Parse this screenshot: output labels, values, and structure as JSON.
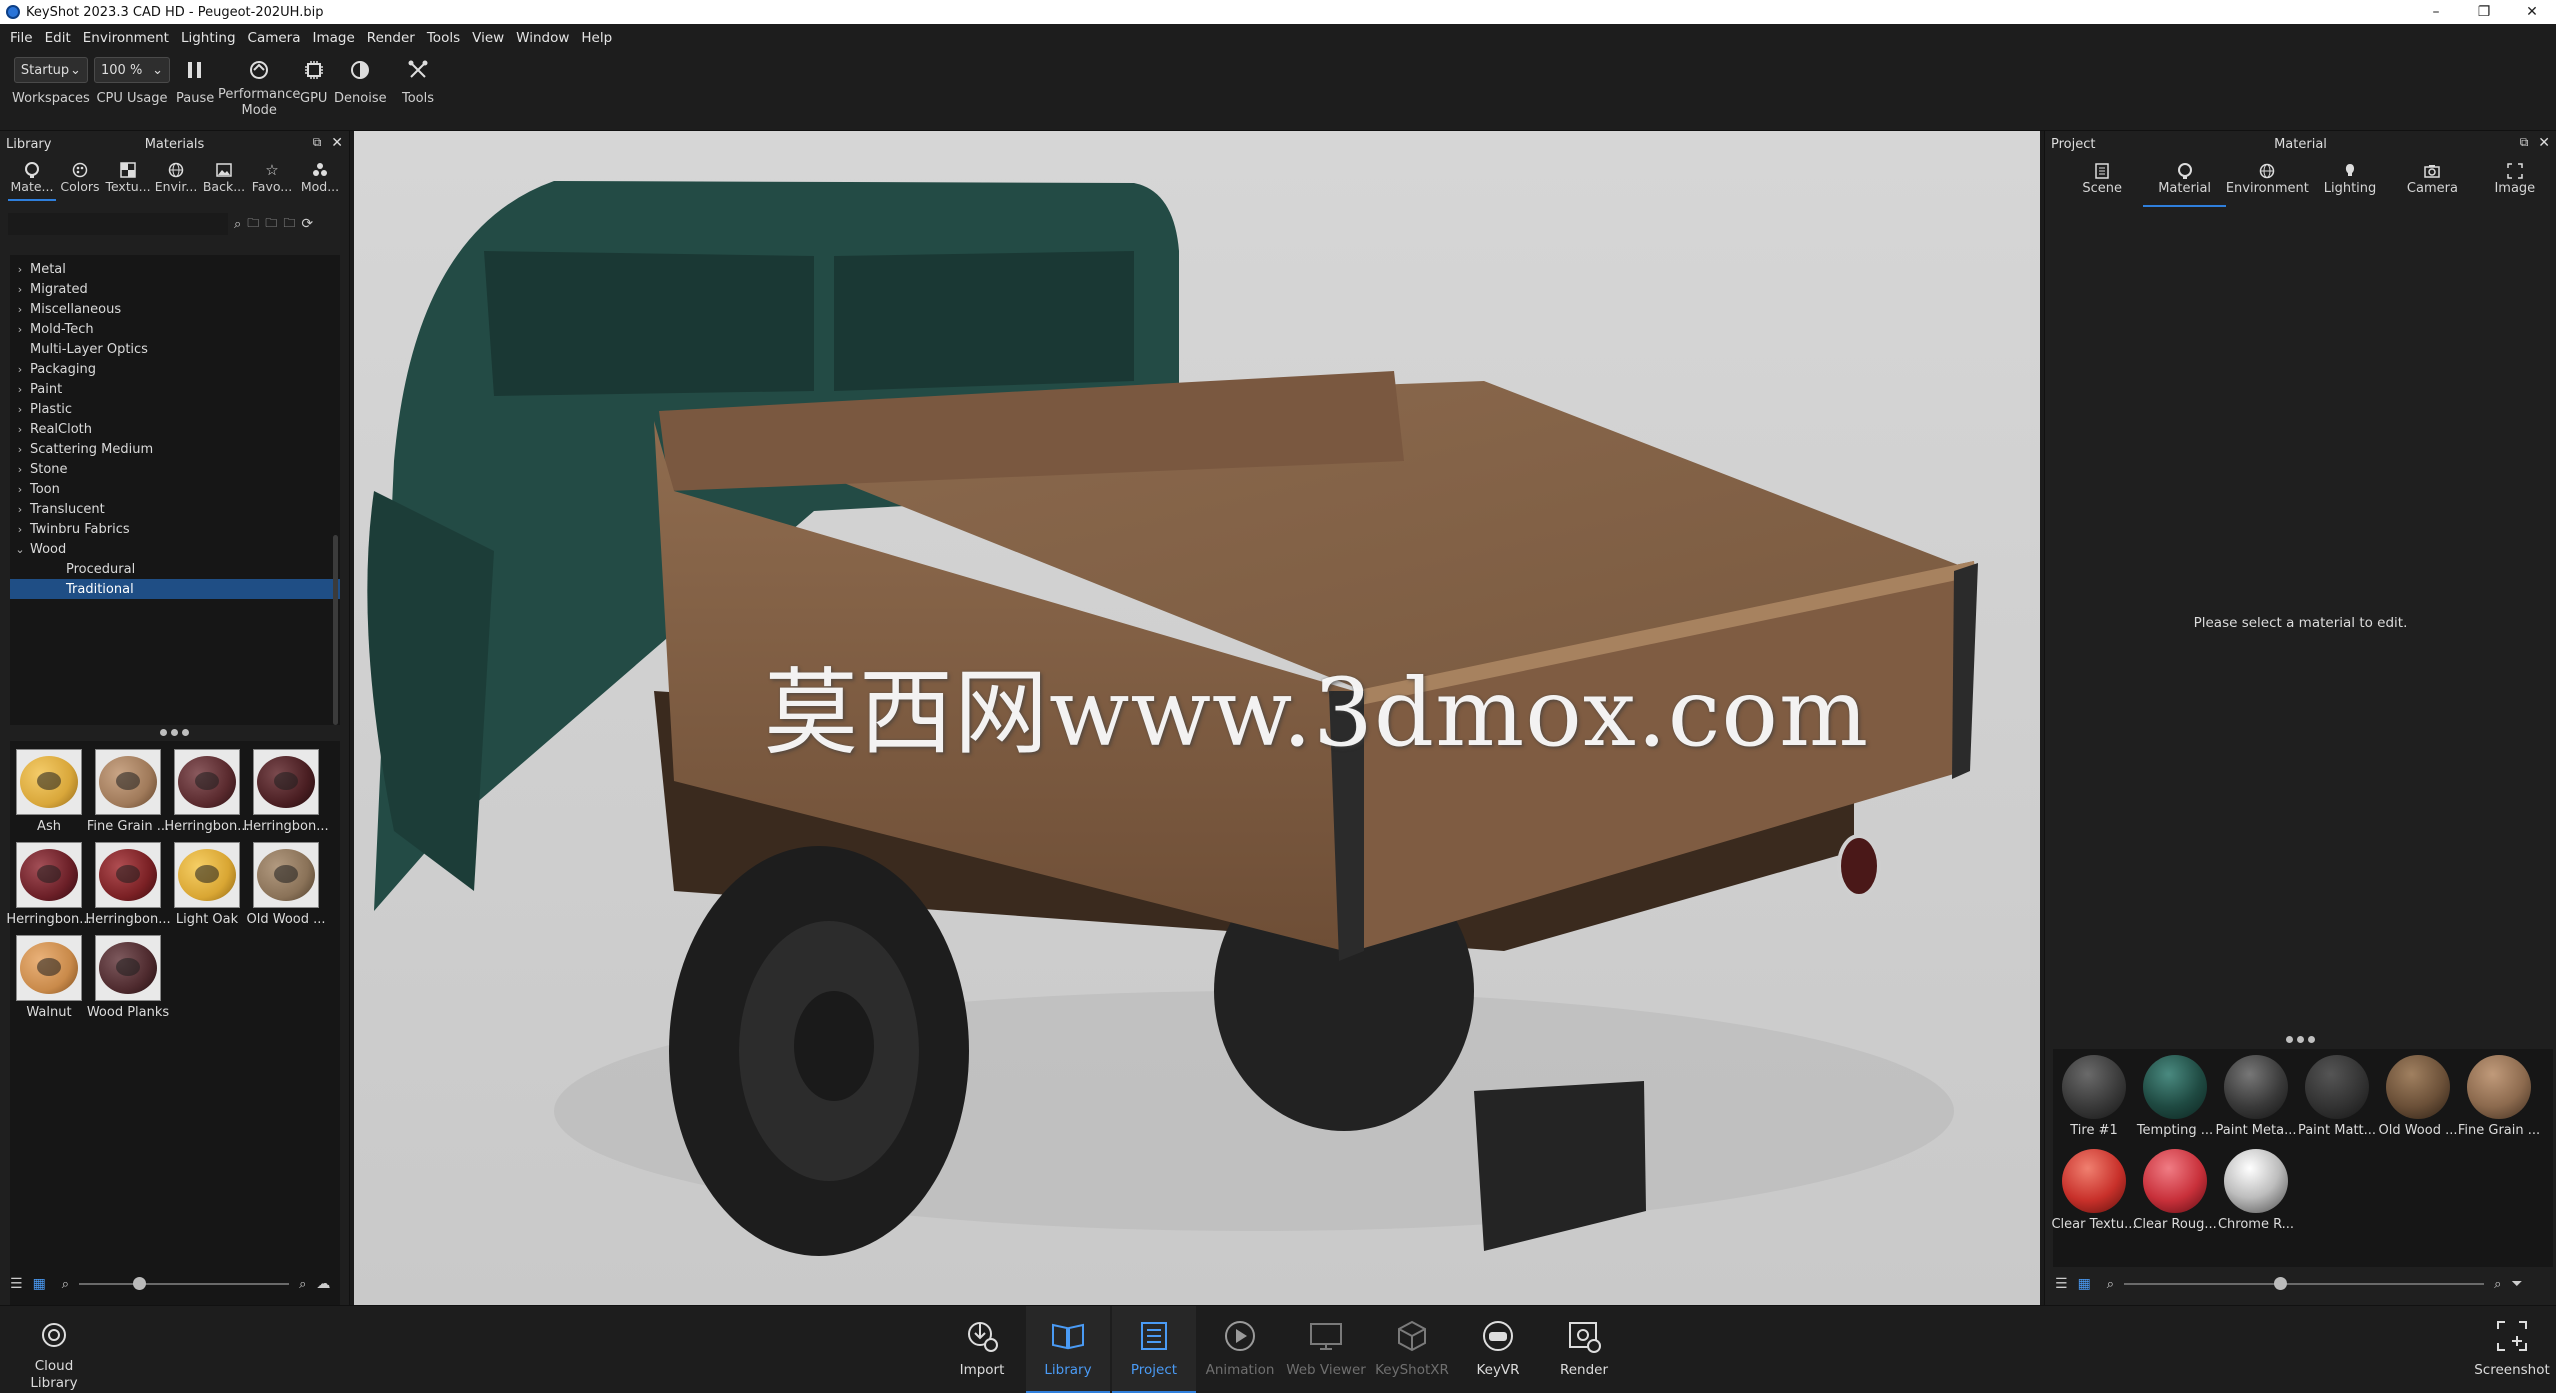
{
  "window": {
    "title": "KeyShot 2023.3 CAD HD  - Peugeot-202UH.bip",
    "minimize": "–",
    "restore": "❐",
    "close": "✕"
  },
  "menu": [
    "File",
    "Edit",
    "Environment",
    "Lighting",
    "Camera",
    "Image",
    "Render",
    "Tools",
    "View",
    "Window",
    "Help"
  ],
  "toolbar": {
    "workspace_value": "Startup",
    "workspaces_label": "Workspaces",
    "cpu_value": "100 %",
    "cpu_label": "CPU Usage",
    "pause_label": "Pause",
    "performance_label_1": "Performance",
    "performance_label_2": "Mode",
    "gpu_label": "GPU",
    "denoise_label": "Denoise",
    "tools_label": "Tools"
  },
  "library": {
    "panel_title": "Library",
    "header_title": "Materials",
    "tabs": [
      "Mate...",
      "Colors",
      "Textu...",
      "Envir...",
      "Back...",
      "Favo...",
      "Mod..."
    ],
    "tree": [
      {
        "label": "Metal",
        "expandable": true
      },
      {
        "label": "Migrated",
        "expandable": true
      },
      {
        "label": "Miscellaneous",
        "expandable": true
      },
      {
        "label": "Mold-Tech",
        "expandable": true
      },
      {
        "label": "Multi-Layer Optics",
        "expandable": false
      },
      {
        "label": "Packaging",
        "expandable": true
      },
      {
        "label": "Paint",
        "expandable": true
      },
      {
        "label": "Plastic",
        "expandable": true
      },
      {
        "label": "RealCloth",
        "expandable": true
      },
      {
        "label": "Scattering Medium",
        "expandable": true
      },
      {
        "label": "Stone",
        "expandable": true
      },
      {
        "label": "Toon",
        "expandable": true
      },
      {
        "label": "Translucent",
        "expandable": true
      },
      {
        "label": "Twinbru Fabrics",
        "expandable": true
      },
      {
        "label": "Wood",
        "expandable": true,
        "expanded": true
      },
      {
        "label": "Procedural",
        "sub": true
      },
      {
        "label": "Traditional",
        "sub": true,
        "selected": true
      }
    ],
    "materials": [
      {
        "label": "Ash",
        "color": "#d9a73a"
      },
      {
        "label": "Fine Grain ...",
        "color": "#a07a5a"
      },
      {
        "label": "Herringbon...",
        "color": "#5a2a2e"
      },
      {
        "label": "Herringbon...",
        "color": "#4a1e22"
      },
      {
        "label": "Herringbon...",
        "color": "#6b1f27"
      },
      {
        "label": "Herringbon...",
        "color": "#7a2024"
      },
      {
        "label": "Light Oak",
        "color": "#d9a633"
      },
      {
        "label": "Old Wood ...",
        "color": "#8a7258"
      },
      {
        "label": "Walnut",
        "color": "#c98a4a"
      },
      {
        "label": "Wood Planks",
        "color": "#4e2a2e"
      }
    ]
  },
  "viewport": {
    "watermark": "莫西网www.3dmox.com"
  },
  "project": {
    "panel_title": "Project",
    "header_title": "Material",
    "tabs": [
      "Scene",
      "Material",
      "Environment",
      "Lighting",
      "Camera",
      "Image"
    ],
    "active_tab": "Material",
    "message": "Please select a material to edit.",
    "scene_materials": [
      {
        "label": "Tire #1",
        "color": "#3a3a3a"
      },
      {
        "label": "Tempting ...",
        "color": "#1f4a42"
      },
      {
        "label": "Paint Meta...",
        "color": "#3a3a3a"
      },
      {
        "label": "Paint Matt...",
        "color": "#333333"
      },
      {
        "label": "Old Wood ...",
        "color": "#6b5038"
      },
      {
        "label": "Fine Grain ...",
        "color": "#8c6a4e"
      },
      {
        "label": "Clear Textu...",
        "color": "#c8302a"
      },
      {
        "label": "Clear Roug...",
        "color": "#c8303a"
      },
      {
        "label": "Chrome R...",
        "color": "#bdbdbd"
      }
    ]
  },
  "bottombar": {
    "cloud_library_1": "Cloud",
    "cloud_library_2": "Library",
    "import": "Import",
    "library": "Library",
    "project": "Project",
    "animation": "Animation",
    "web_viewer": "Web Viewer",
    "keyshotxr": "KeyShotXR",
    "keyvr": "KeyVR",
    "render": "Render",
    "screenshot": "Screenshot"
  },
  "colors": {
    "accent": "#2f7fdc",
    "selection": "#1f4e85",
    "panel": "#1f1f1f",
    "truck_cab": "#234b45",
    "truck_bed": "#7a5840"
  }
}
